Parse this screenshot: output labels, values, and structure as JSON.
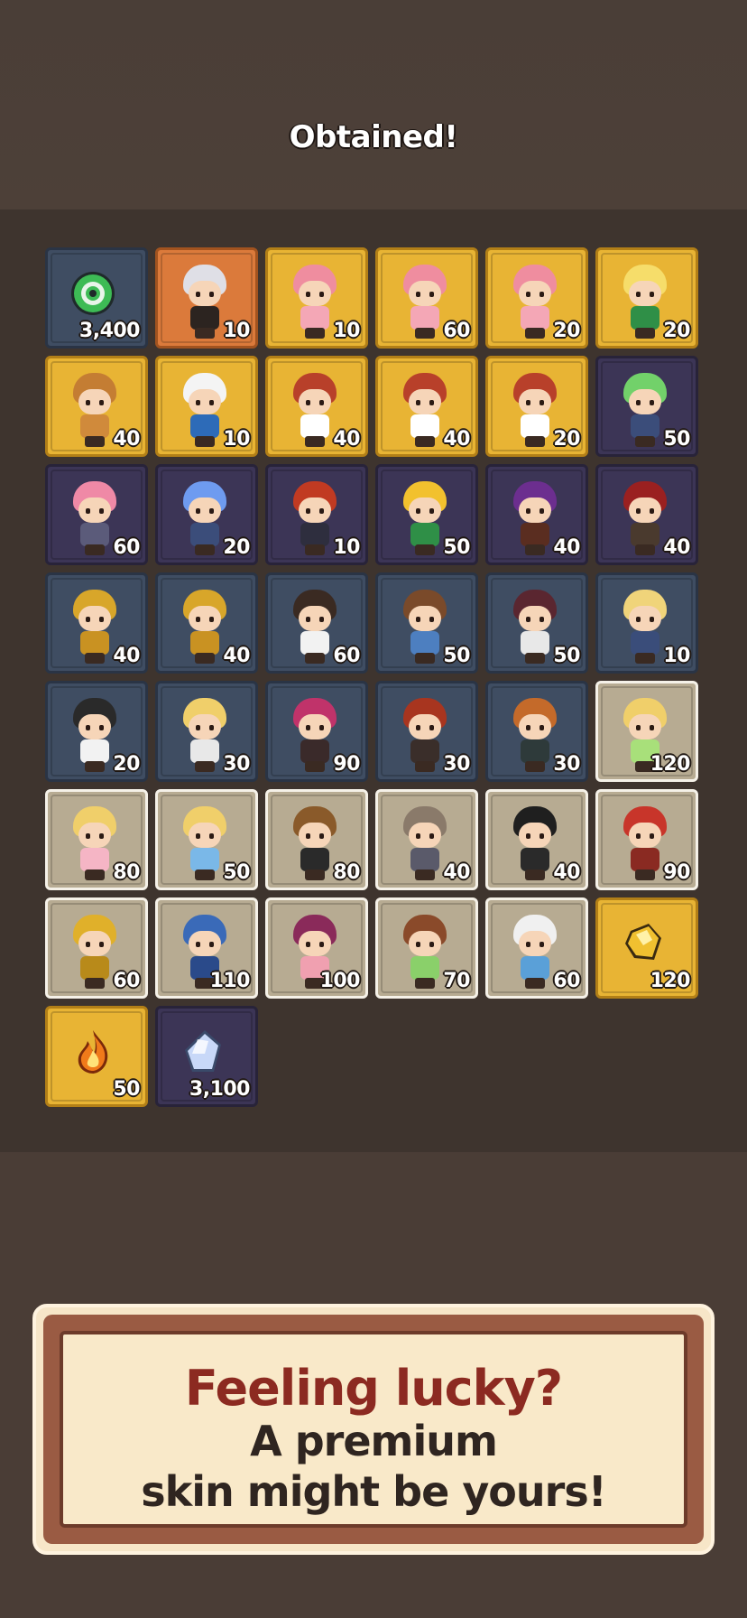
{
  "header": {
    "title": "Obtained!"
  },
  "rewards": [
    {
      "count": "3,400",
      "tier": "blue",
      "kind": "item",
      "icon": "green-ring-icon",
      "color": "#3dbb55"
    },
    {
      "count": "10",
      "tier": "orange",
      "kind": "hero",
      "icon": "pumpkin-witch",
      "hair": "#dfdfe6",
      "outfit": "#2c2420"
    },
    {
      "count": "10",
      "tier": "gold",
      "kind": "hero",
      "icon": "cherry-girl",
      "hair": "#ef8d9f",
      "outfit": "#f4a7b6"
    },
    {
      "count": "60",
      "tier": "gold",
      "kind": "hero",
      "icon": "cherry-girl",
      "hair": "#ef8d9f",
      "outfit": "#f4a7b6"
    },
    {
      "count": "20",
      "tier": "gold",
      "kind": "hero",
      "icon": "cherry-girl",
      "hair": "#ef8d9f",
      "outfit": "#f4a7b6"
    },
    {
      "count": "20",
      "tier": "gold",
      "kind": "hero",
      "icon": "santa-girl",
      "hair": "#f6dd6a",
      "outfit": "#2f8f47"
    },
    {
      "count": "40",
      "tier": "gold",
      "kind": "hero",
      "icon": "reindeer-costume",
      "hair": "#c47d33",
      "outfit": "#d08a3b"
    },
    {
      "count": "10",
      "tier": "gold",
      "kind": "hero",
      "icon": "snowman-costume",
      "hair": "#f4f4f4",
      "outfit": "#2d6bb8"
    },
    {
      "count": "40",
      "tier": "gold",
      "kind": "hero",
      "icon": "goggles-hero",
      "hair": "#b8402a",
      "outfit": "#ffffff"
    },
    {
      "count": "40",
      "tier": "gold",
      "kind": "hero",
      "icon": "goggles-hero",
      "hair": "#b8402a",
      "outfit": "#ffffff"
    },
    {
      "count": "20",
      "tier": "gold",
      "kind": "hero",
      "icon": "goggles-hero",
      "hair": "#b8402a",
      "outfit": "#ffffff"
    },
    {
      "count": "50",
      "tier": "purple",
      "kind": "hero",
      "icon": "green-horned-hero",
      "hair": "#72d16a",
      "outfit": "#3b4d7a"
    },
    {
      "count": "60",
      "tier": "purple",
      "kind": "hero",
      "icon": "pink-horned-hero",
      "hair": "#ef89a6",
      "outfit": "#5b5b7a"
    },
    {
      "count": "20",
      "tier": "purple",
      "kind": "hero",
      "icon": "blue-horned-hero",
      "hair": "#6e9bf0",
      "outfit": "#3b4d7a"
    },
    {
      "count": "10",
      "tier": "purple",
      "kind": "hero",
      "icon": "red-haired-swordsman",
      "hair": "#c13a22",
      "outfit": "#2e2e3e"
    },
    {
      "count": "50",
      "tier": "purple",
      "kind": "hero",
      "icon": "twin-tail-hero",
      "hair": "#f2c12e",
      "outfit": "#2f8f47"
    },
    {
      "count": "40",
      "tier": "purple",
      "kind": "hero",
      "icon": "hooded-mage",
      "hair": "#6c2e8f",
      "outfit": "#5a2d20"
    },
    {
      "count": "40",
      "tier": "purple",
      "kind": "hero",
      "icon": "pirate-captain",
      "hair": "#9a2020",
      "outfit": "#4a3a2e"
    },
    {
      "count": "40",
      "tier": "blue",
      "kind": "hero",
      "icon": "spartan-green",
      "hair": "#d8a62a",
      "outfit": "#c99222"
    },
    {
      "count": "40",
      "tier": "blue",
      "kind": "hero",
      "icon": "spartan-red",
      "hair": "#d8a62a",
      "outfit": "#c99222"
    },
    {
      "count": "60",
      "tier": "blue",
      "kind": "hero",
      "icon": "doctor",
      "hair": "#3a2a22",
      "outfit": "#f2f2f2"
    },
    {
      "count": "50",
      "tier": "blue",
      "kind": "hero",
      "icon": "blue-uniform",
      "hair": "#7a4a2a",
      "outfit": "#4d7fc0"
    },
    {
      "count": "50",
      "tier": "blue",
      "kind": "hero",
      "icon": "lab-coat",
      "hair": "#5a2630",
      "outfit": "#e8e8e8"
    },
    {
      "count": "10",
      "tier": "blue",
      "kind": "hero",
      "icon": "blonde-goggles",
      "hair": "#f0d47a",
      "outfit": "#3a4d7a"
    },
    {
      "count": "20",
      "tier": "blue",
      "kind": "hero",
      "icon": "beanie-photographer",
      "hair": "#2a2a2a",
      "outfit": "#f2f2f2"
    },
    {
      "count": "30",
      "tier": "blue",
      "kind": "hero",
      "icon": "blonde-ponytail",
      "hair": "#f0cf6a",
      "outfit": "#e8e8e8"
    },
    {
      "count": "90",
      "tier": "blue",
      "kind": "hero",
      "icon": "magenta-hair",
      "hair": "#c0336a",
      "outfit": "#3a2a2a"
    },
    {
      "count": "30",
      "tier": "blue",
      "kind": "hero",
      "icon": "red-spiky",
      "hair": "#a8351f",
      "outfit": "#3a2e2a"
    },
    {
      "count": "30",
      "tier": "blue",
      "kind": "hero",
      "icon": "orange-hair",
      "hair": "#c46a2a",
      "outfit": "#2e3a3a"
    },
    {
      "count": "120",
      "tier": "silver",
      "kind": "hero",
      "icon": "nurse-blonde",
      "hair": "#f0cf6a",
      "outfit": "#a8e07a"
    },
    {
      "count": "80",
      "tier": "silver",
      "kind": "hero",
      "icon": "nurse-pink",
      "hair": "#f0cf6a",
      "outfit": "#f5b5c5"
    },
    {
      "count": "50",
      "tier": "silver",
      "kind": "hero",
      "icon": "nurse-blue",
      "hair": "#f0cf6a",
      "outfit": "#7ab8e8"
    },
    {
      "count": "80",
      "tier": "silver",
      "kind": "hero",
      "icon": "suit-brown-hair",
      "hair": "#8a5a2a",
      "outfit": "#2a2a2a"
    },
    {
      "count": "40",
      "tier": "silver",
      "kind": "hero",
      "icon": "long-hair-grey",
      "hair": "#8a7a6a",
      "outfit": "#5a5a6a"
    },
    {
      "count": "40",
      "tier": "silver",
      "kind": "hero",
      "icon": "black-hair-suit",
      "hair": "#1f1f1f",
      "outfit": "#2a2a2a"
    },
    {
      "count": "90",
      "tier": "silver",
      "kind": "hero",
      "icon": "red-robot",
      "hair": "#c8352a",
      "outfit": "#8a2a22"
    },
    {
      "count": "60",
      "tier": "silver",
      "kind": "hero",
      "icon": "yellow-robot",
      "hair": "#e0b02a",
      "outfit": "#b88a1a"
    },
    {
      "count": "110",
      "tier": "silver",
      "kind": "hero",
      "icon": "blue-robot",
      "hair": "#3a6ab8",
      "outfit": "#2a4a8a"
    },
    {
      "count": "100",
      "tier": "silver",
      "kind": "hero",
      "icon": "kimono-girl",
      "hair": "#8a2a5a",
      "outfit": "#f0a0b0"
    },
    {
      "count": "70",
      "tier": "silver",
      "kind": "hero",
      "icon": "green-outfit-boy",
      "hair": "#8a4a2a",
      "outfit": "#8ad06a"
    },
    {
      "count": "60",
      "tier": "silver",
      "kind": "hero",
      "icon": "white-cap-boy",
      "hair": "#f0f0f0",
      "outfit": "#5aa0d8"
    },
    {
      "count": "120",
      "tier": "gold",
      "kind": "item",
      "icon": "gold-crystal-icon",
      "color": "#f0c030"
    },
    {
      "count": "50",
      "tier": "gold",
      "kind": "item",
      "icon": "fire-icon",
      "color": "#f07a1a"
    },
    {
      "count": "3,100",
      "tier": "purple",
      "kind": "item",
      "icon": "crystal-gem-icon",
      "color": "#c8d8f8"
    }
  ],
  "banner": {
    "line1": "Feeling lucky?",
    "line2": "A premium",
    "line3": "skin might be yours!"
  }
}
